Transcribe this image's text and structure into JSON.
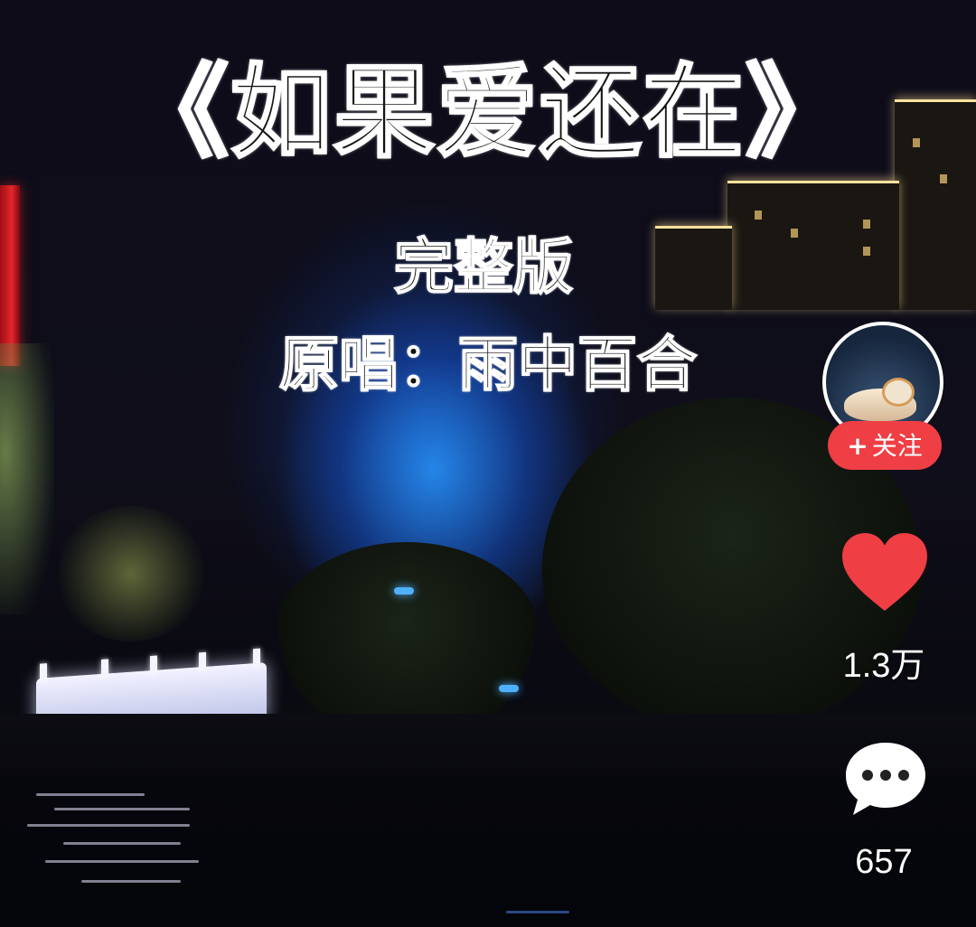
{
  "video": {
    "title": "《如果爱还在》",
    "subtitle_edition": "完整版",
    "subtitle_singer": "原唱：雨中百合"
  },
  "author": {
    "avatar_icon": "avatar-image",
    "follow_label": "关注",
    "follow_plus": "+"
  },
  "actions": {
    "like_icon": "heart-icon",
    "like_color": "#ef3e44",
    "like_count": "1.3万",
    "comment_icon": "chat-bubble-icon",
    "comment_count": "657"
  }
}
